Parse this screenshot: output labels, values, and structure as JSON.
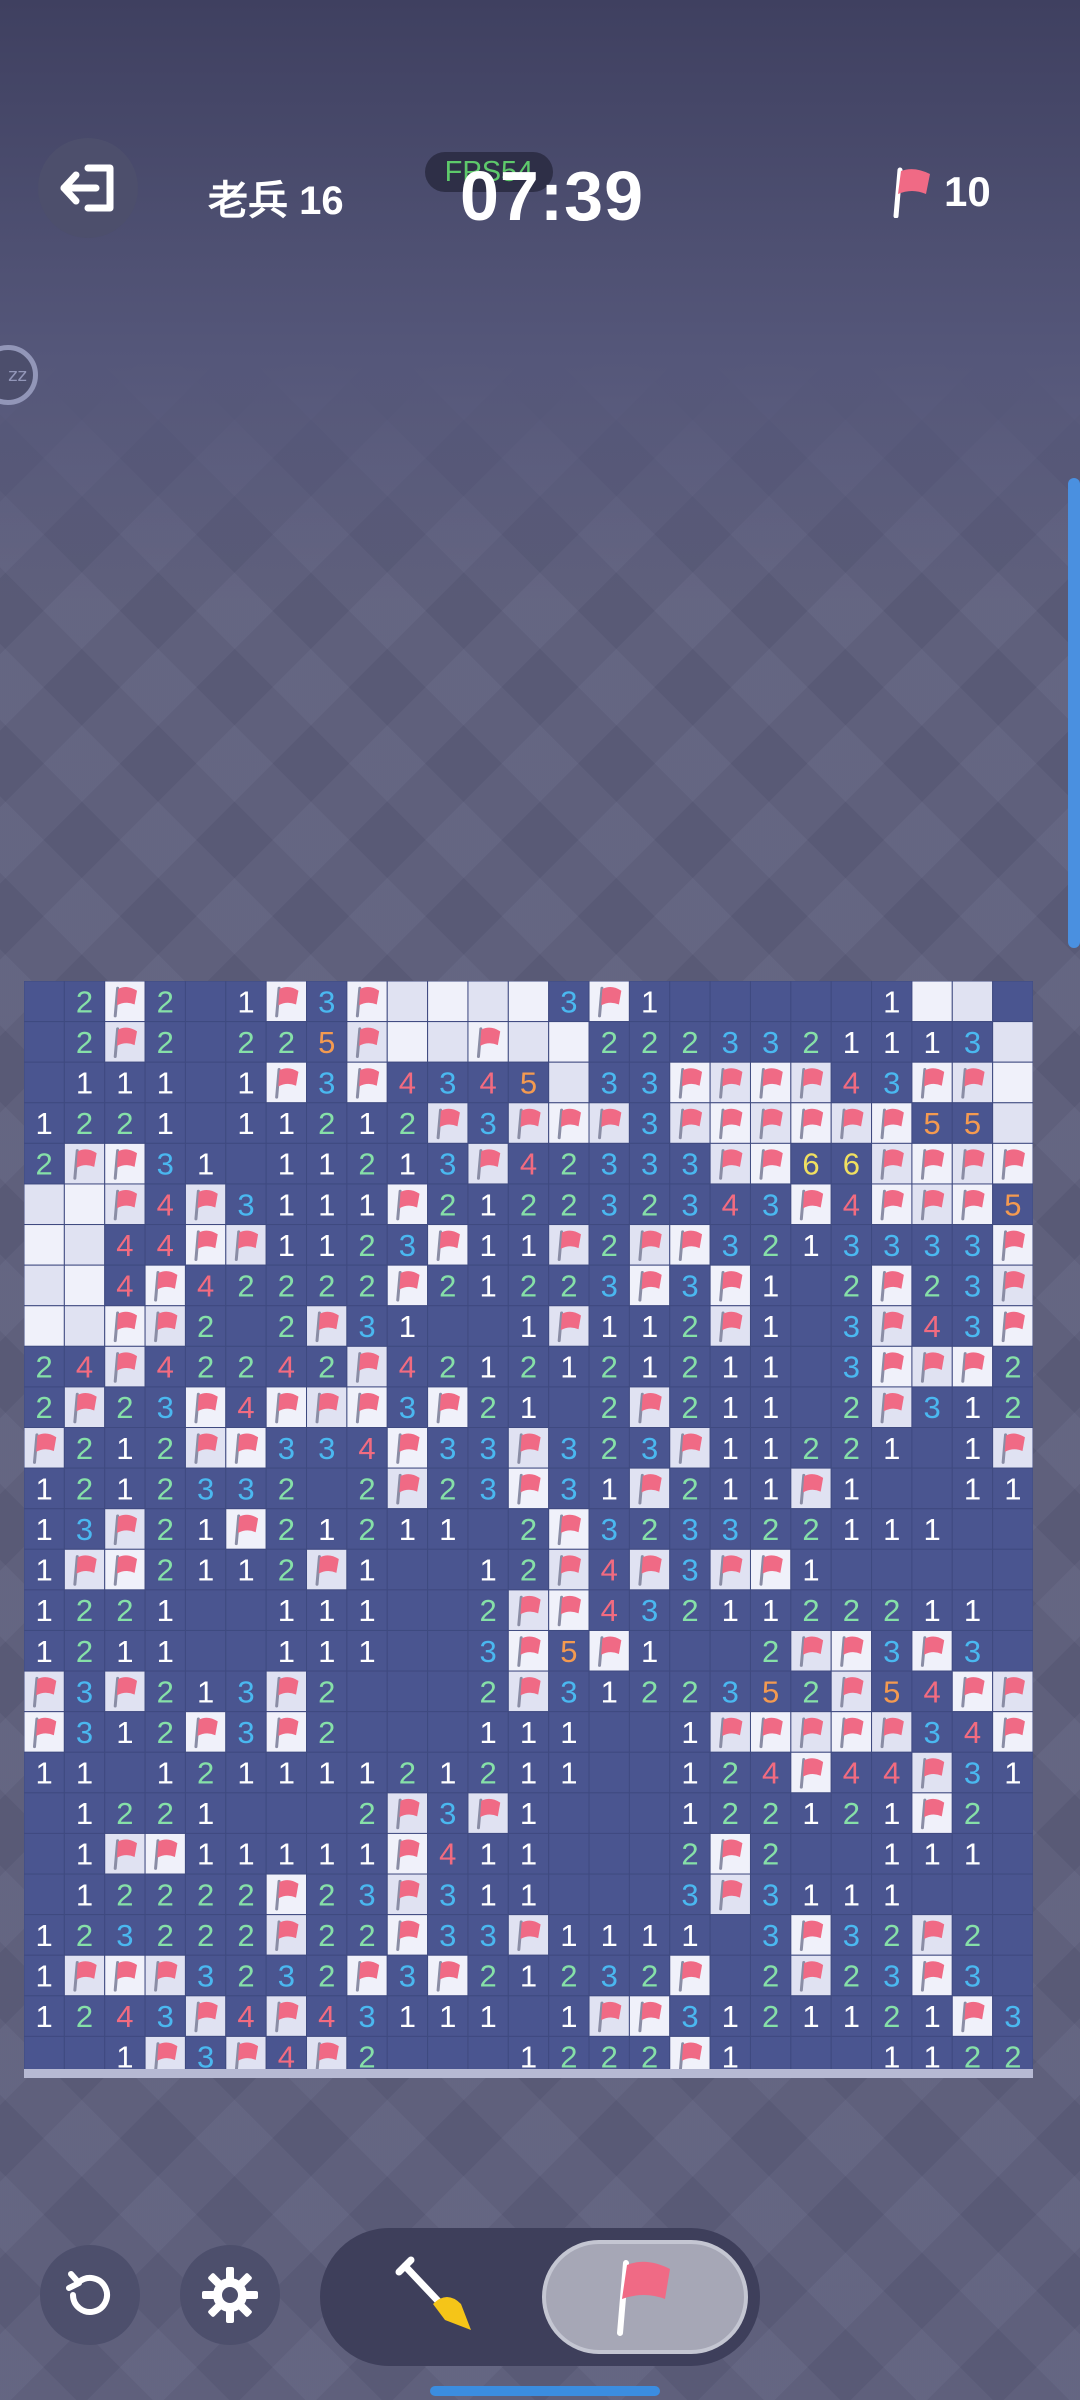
{
  "header": {
    "rank_label": "老兵 16",
    "fps_label": "FPS54",
    "timer": "07:39",
    "flags_remaining": "10",
    "exit_icon": "exit-icon",
    "flag_icon": "flag-icon"
  },
  "sleep_badge": "zz",
  "toolbar": {
    "undo_icon": "undo-icon",
    "settings_icon": "gear-icon",
    "dig_icon": "shovel-icon",
    "flag_mode_icon": "flag-icon",
    "active_mode": "flag"
  },
  "colors": {
    "board_revealed": "#4a5590",
    "board_unrevealed_light": "#f0f1fa",
    "board_unrevealed_dark": "#e0e2f2",
    "num_1": "#ffffff",
    "num_2": "#86e0a8",
    "num_3": "#4ab8f0",
    "num_4": "#f26b80",
    "num_5": "#f49a50",
    "num_6": "#f0e060",
    "num_7": "#b070f0",
    "flag": "#f06a85"
  },
  "board": {
    "cols": 25,
    "rows": 27,
    "legend": "# = unrevealed, F = flag, . = empty revealed, digits = mine count",
    "grid": [
      ".2F2.1F3F####3F1.....1##",
      ".2F2.225F##F##2223321113##",
      ".111.1F3F4345#33FFFF43FF#",
      "1221.11212F3FFF3FFFFFF55#",
      "2FF31.11213F42333FF66FFFF",
      "##F4F3111F212232343F4FFF54",
      "##44FF1123F11F2FF3213333F3",
      "##4F42222F21223F3F1.2F23F3",
      "##FF2.2F31..1F112F1.3F43F2",
      "24F42242F4212121211.3FFF21",
      "2F23F4FFF3F21.2F211.2F3121",
      "F212FF334F33F323F11221.1F",
      "1212332.2F23F31F211F1..11",
      "13F21F21211.2F323322111..",
      "1FF2112F1..12F4F3FF1.....",
      "1221..111..2FF4321122211.",
      "1211..111..3F5F1..2FF3F3.",
      "F3F213F2...2F3122352F54FF",
      "F312F3F2...111..1FFFFF34F",
      "11.12111121211..124F44F31",
      ".1221...2F3F1...122121F2.",
      ".1FF11111F411...2F2..111.",
      ".12222F23F311...3F3111...",
      "123222F22F33F1111.3F32F2.",
      "1FFF3232F3F21232F.2F23F3.",
      "1243F4F43111.1FF3121121F3111",
      "..1F3F4F2...1222F1...1122F1"
    ]
  }
}
